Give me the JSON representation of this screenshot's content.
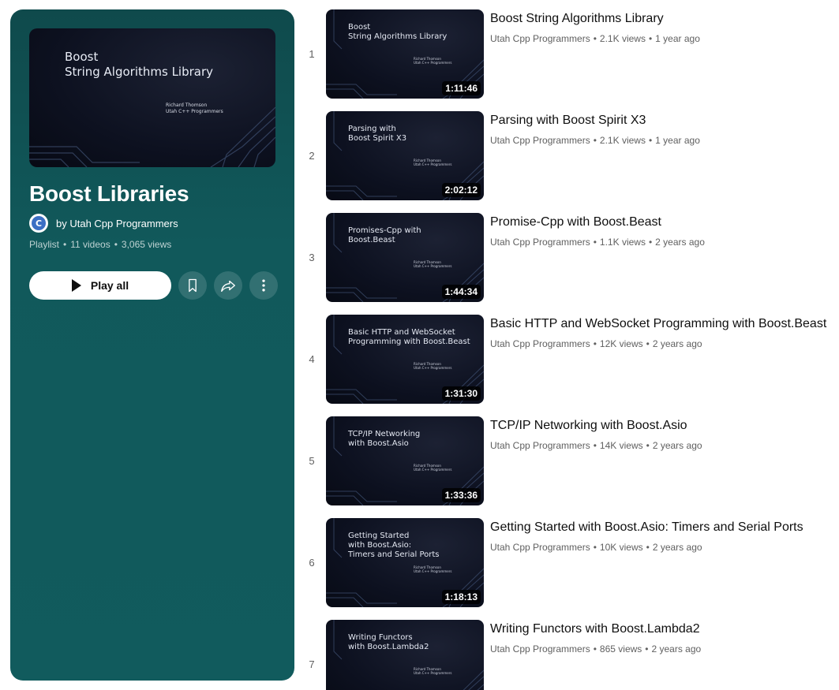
{
  "playlist": {
    "hero_title_line1": "Boost",
    "hero_title_line2": "String Algorithms Library",
    "hero_sub_line1": "Richard Thomson",
    "hero_sub_line2": "Utah C++ Programmers",
    "title": "Boost Libraries",
    "owner": "by Utah Cpp Programmers",
    "avatar_letter": "C",
    "type": "Playlist",
    "video_count": "11 videos",
    "views": "3,065 views",
    "separator": "•",
    "play_all_label": "Play all"
  },
  "icons": {
    "play": "play-icon",
    "save": "bookmark-icon",
    "share": "share-icon",
    "more": "more-vert-icon"
  },
  "colors": {
    "panel": "#115b5d",
    "duration_bg": "#000000"
  },
  "videos": [
    {
      "index": "1",
      "title": "Boost String Algorithms Library",
      "channel": "Utah Cpp Programmers",
      "views": "2.1K views",
      "age": "1 year ago",
      "duration": "1:11:46",
      "thumb_title": "Boost\nString Algorithms Library",
      "thumb_sub": "Richard Thomson\nUtah C++ Programmers"
    },
    {
      "index": "2",
      "title": "Parsing with Boost Spirit X3",
      "channel": "Utah Cpp Programmers",
      "views": "2.1K views",
      "age": "1 year ago",
      "duration": "2:02:12",
      "thumb_title": "Parsing with\nBoost Spirit X3",
      "thumb_sub": "Richard Thomson\nUtah C++ Programmers"
    },
    {
      "index": "3",
      "title": "Promise-Cpp with Boost.Beast",
      "channel": "Utah Cpp Programmers",
      "views": "1.1K views",
      "age": "2 years ago",
      "duration": "1:44:34",
      "thumb_title": "Promises-Cpp with\nBoost.Beast",
      "thumb_sub": "Richard Thomson\nUtah C++ Programmers"
    },
    {
      "index": "4",
      "title": "Basic HTTP and WebSocket Programming with Boost.Beast",
      "channel": "Utah Cpp Programmers",
      "views": "12K views",
      "age": "2 years ago",
      "duration": "1:31:30",
      "thumb_title": "Basic HTTP and WebSocket\nProgramming with Boost.Beast",
      "thumb_sub": "Richard Thomson\nUtah C++ Programmers"
    },
    {
      "index": "5",
      "title": "TCP/IP Networking with Boost.Asio",
      "channel": "Utah Cpp Programmers",
      "views": "14K views",
      "age": "2 years ago",
      "duration": "1:33:36",
      "thumb_title": "TCP/IP Networking\nwith Boost.Asio",
      "thumb_sub": "Richard Thomson\nUtah C++ Programmers"
    },
    {
      "index": "6",
      "title": "Getting Started with Boost.Asio: Timers and Serial Ports",
      "channel": "Utah Cpp Programmers",
      "views": "10K views",
      "age": "2 years ago",
      "duration": "1:18:13",
      "thumb_title": "Getting Started\nwith Boost.Asio:\nTimers and Serial Ports",
      "thumb_sub": "Richard Thomson\nUtah C++ Programmers"
    },
    {
      "index": "7",
      "title": "Writing Functors with Boost.Lambda2",
      "channel": "Utah Cpp Programmers",
      "views": "865 views",
      "age": "2 years ago",
      "duration": "",
      "thumb_title": "Writing Functors\nwith Boost.Lambda2",
      "thumb_sub": "Richard Thomson\nUtah C++ Programmers"
    }
  ]
}
